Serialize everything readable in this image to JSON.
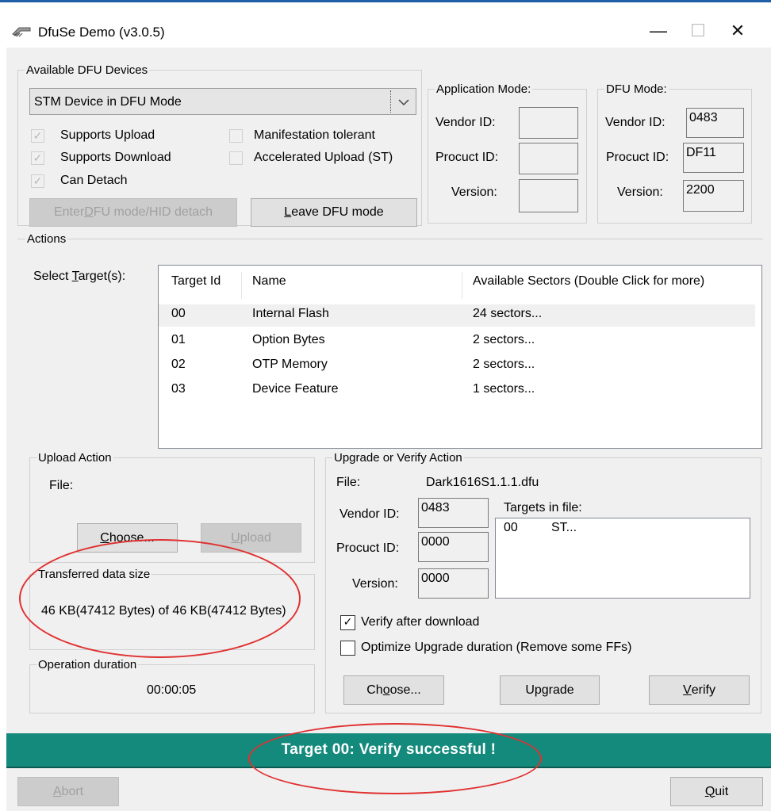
{
  "window": {
    "title": "DfuSe Demo (v3.0.5)",
    "min": "—",
    "max": "☐",
    "close": "✕"
  },
  "devices": {
    "group_label": "Available DFU Devices",
    "selected_device": "STM Device in DFU Mode",
    "caps": [
      {
        "label": "Supports Upload",
        "checked": true
      },
      {
        "label": "Supports Download",
        "checked": true
      },
      {
        "label": "Can Detach",
        "checked": true
      },
      {
        "label": "Manifestation tolerant",
        "checked": false
      },
      {
        "label": "Accelerated Upload (ST)",
        "checked": false
      }
    ],
    "enter_dfu_pre": "Enter ",
    "enter_dfu_u": "D",
    "enter_dfu_post": "FU mode/HID detach",
    "leave_dfu_u": "L",
    "leave_dfu_post": "eave DFU mode"
  },
  "app_mode": {
    "label": "Application Mode:",
    "vendor_label": "Vendor ID:",
    "product_label": "Procuct ID:",
    "version_label": "Version:",
    "vendor": "",
    "product": "",
    "version": ""
  },
  "dfu_mode": {
    "label": "DFU Mode:",
    "vendor_label": "Vendor ID:",
    "product_label": "Procuct ID:",
    "version_label": "Version:",
    "vendor": "0483",
    "product": "DF11",
    "version": "2200"
  },
  "actions": {
    "group_label": "Actions",
    "select_target_pre": "Select ",
    "select_target_u": "T",
    "select_target_post": "arget(s):",
    "columns": [
      "Target Id",
      "Name",
      "Available Sectors (Double Click for more)"
    ],
    "targets": [
      {
        "id": "00",
        "name": "Internal Flash",
        "sectors": "24 sectors..."
      },
      {
        "id": "01",
        "name": "Option Bytes",
        "sectors": "2 sectors..."
      },
      {
        "id": "02",
        "name": "OTP Memory",
        "sectors": "2 sectors..."
      },
      {
        "id": "03",
        "name": "Device Feature",
        "sectors": "1 sectors..."
      }
    ]
  },
  "upload": {
    "group_label": "Upload Action",
    "file_label": "File:",
    "choose_u": "C",
    "choose_post": "hoose...",
    "upload_u": "U",
    "upload_post": "pload"
  },
  "transfer": {
    "group_label": "Transferred data size",
    "text": "46 KB(47412 Bytes) of 46 KB(47412 Bytes)"
  },
  "duration": {
    "group_label": "Operation duration",
    "value": "00:00:05"
  },
  "upgrade": {
    "group_label": "Upgrade or Verify Action",
    "file_label": "File:",
    "file_value": "Dark1616S1.1.1.dfu",
    "vendor_label": "Vendor ID:",
    "product_label": "Procuct ID:",
    "version_label": "Version:",
    "vendor": "0483",
    "product": "0000",
    "version": "0000",
    "targets_label": "Targets in file:",
    "file_targets": [
      {
        "id": "00",
        "name": "ST..."
      }
    ],
    "verify_after": {
      "label": "Verify after download",
      "checked": true
    },
    "optimize": {
      "label": "Optimize Upgrade duration (Remove some FFs)",
      "checked": false
    },
    "choose_pre": "Ch",
    "choose_u": "o",
    "choose_post": "ose...",
    "upgrade_label": "Upgrade",
    "verify_u": "V",
    "verify_post": "erify"
  },
  "status": {
    "text": "Target 00: Verify successful !",
    "color": "#138a7c"
  },
  "bottom": {
    "abort_u": "A",
    "abort_post": "bort",
    "quit_u": "Q",
    "quit_post": "uit"
  }
}
